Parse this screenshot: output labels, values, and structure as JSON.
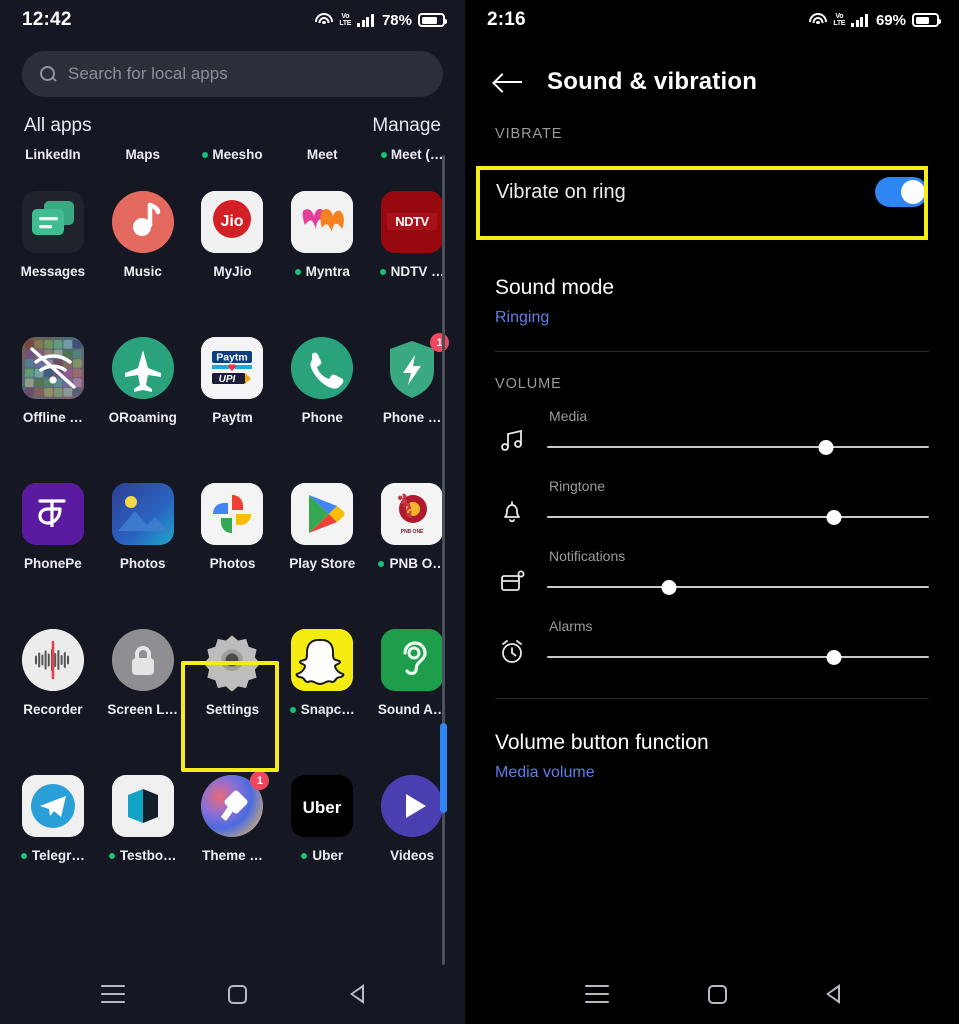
{
  "left_phone": {
    "status_bar": {
      "time": "12:42",
      "wifi_icon": "wifi-icon",
      "volte_icon": "volte-icon",
      "volte_text_top": "Vo",
      "volte_text_bottom": "LTE",
      "signal_icon": "signal-bars-icon",
      "battery_percent": "78%",
      "battery_icon": "battery-icon"
    },
    "search": {
      "icon": "search-icon",
      "placeholder": "Search for local apps",
      "value": ""
    },
    "apps_header": {
      "title": "All apps",
      "manage_label": "Manage"
    },
    "cut_row_labels": [
      {
        "label": "LinkedIn",
        "dot": false
      },
      {
        "label": "Maps",
        "dot": false
      },
      {
        "label": "Meesho",
        "dot": true
      },
      {
        "label": "Meet",
        "dot": false
      },
      {
        "label": "Meet (…",
        "dot": true
      }
    ],
    "apps": [
      {
        "label": "Messages",
        "dot": false,
        "badge": "",
        "icon": "messages-icon"
      },
      {
        "label": "Music",
        "dot": false,
        "badge": "",
        "icon": "music-icon"
      },
      {
        "label": "MyJio",
        "dot": false,
        "badge": "",
        "icon": "myjio-icon"
      },
      {
        "label": "Myntra",
        "dot": true,
        "badge": "",
        "icon": "myntra-icon"
      },
      {
        "label": "NDTV …",
        "dot": true,
        "badge": "",
        "icon": "ndtv-icon"
      },
      {
        "label": "Offline …",
        "dot": false,
        "badge": "",
        "icon": "offline-apps-icon"
      },
      {
        "label": "ORoaming",
        "dot": false,
        "badge": "",
        "icon": "oroaming-icon"
      },
      {
        "label": "Paytm",
        "dot": false,
        "badge": "",
        "icon": "paytm-icon"
      },
      {
        "label": "Phone",
        "dot": false,
        "badge": "",
        "icon": "phone-icon"
      },
      {
        "label": "Phone …",
        "dot": false,
        "badge": "1",
        "icon": "phone-manager-icon"
      },
      {
        "label": "PhonePe",
        "dot": false,
        "badge": "",
        "icon": "phonepe-icon"
      },
      {
        "label": "Photos",
        "dot": false,
        "badge": "",
        "icon": "photos-gallery-icon"
      },
      {
        "label": "Photos",
        "dot": false,
        "badge": "",
        "icon": "google-photos-icon"
      },
      {
        "label": "Play Store",
        "dot": false,
        "badge": "",
        "icon": "play-store-icon"
      },
      {
        "label": "PNB O…",
        "dot": true,
        "badge": "",
        "icon": "pnb-icon"
      },
      {
        "label": "Recorder",
        "dot": false,
        "badge": "",
        "icon": "recorder-icon"
      },
      {
        "label": "Screen L…",
        "dot": false,
        "badge": "",
        "icon": "screen-lock-icon"
      },
      {
        "label": "Settings",
        "dot": false,
        "badge": "",
        "icon": "settings-gear-icon"
      },
      {
        "label": "Snapc…",
        "dot": true,
        "badge": "",
        "icon": "snapchat-icon"
      },
      {
        "label": "Sound A…",
        "dot": false,
        "badge": "",
        "icon": "sound-assist-icon"
      },
      {
        "label": "Telegr…",
        "dot": true,
        "badge": "",
        "icon": "telegram-icon"
      },
      {
        "label": "Testbo…",
        "dot": true,
        "badge": "",
        "icon": "testbook-icon"
      },
      {
        "label": "Theme …",
        "dot": false,
        "badge": "1",
        "icon": "theme-store-icon"
      },
      {
        "label": "Uber",
        "dot": true,
        "badge": "",
        "icon": "uber-icon"
      },
      {
        "label": "Videos",
        "dot": false,
        "badge": "",
        "icon": "videos-icon"
      }
    ],
    "highlight": {
      "target": "Settings",
      "color": "#f6ec18"
    },
    "scrollbar": {
      "color": "#2e86f5"
    },
    "nav": {
      "menu": "menu-icon",
      "home": "home-icon",
      "back": "back-icon"
    }
  },
  "right_phone": {
    "status_bar": {
      "time": "2:16",
      "wifi_icon": "wifi-icon",
      "volte_icon": "volte-icon",
      "volte_text_top": "Vo",
      "volte_text_bottom": "LTE",
      "signal_icon": "signal-bars-icon",
      "battery_percent": "69%",
      "battery_icon": "battery-icon"
    },
    "header": {
      "back_icon": "back-arrow-icon",
      "title": "Sound & vibration"
    },
    "vibrate_section": {
      "label": "VIBRATE",
      "row_title": "Vibrate on ring",
      "toggle_state": "on",
      "toggle_color": "#2e86f5",
      "highlight_color": "#f6ec18"
    },
    "sound_mode": {
      "title": "Sound mode",
      "value": "Ringing",
      "value_color": "#5f7fe8"
    },
    "volume_section": {
      "label": "VOLUME",
      "sliders": [
        {
          "caption": "Media",
          "icon": "music-note-icon",
          "percent": 73
        },
        {
          "caption": "Ringtone",
          "icon": "bell-icon",
          "percent": 75
        },
        {
          "caption": "Notifications",
          "icon": "notification-icon",
          "percent": 32
        },
        {
          "caption": "Alarms",
          "icon": "alarm-clock-icon",
          "percent": 75
        }
      ]
    },
    "volume_button_function": {
      "title": "Volume button function",
      "value": "Media volume",
      "value_color": "#5f7fe8"
    },
    "nav": {
      "menu": "menu-icon",
      "home": "home-icon",
      "back": "back-icon"
    }
  }
}
